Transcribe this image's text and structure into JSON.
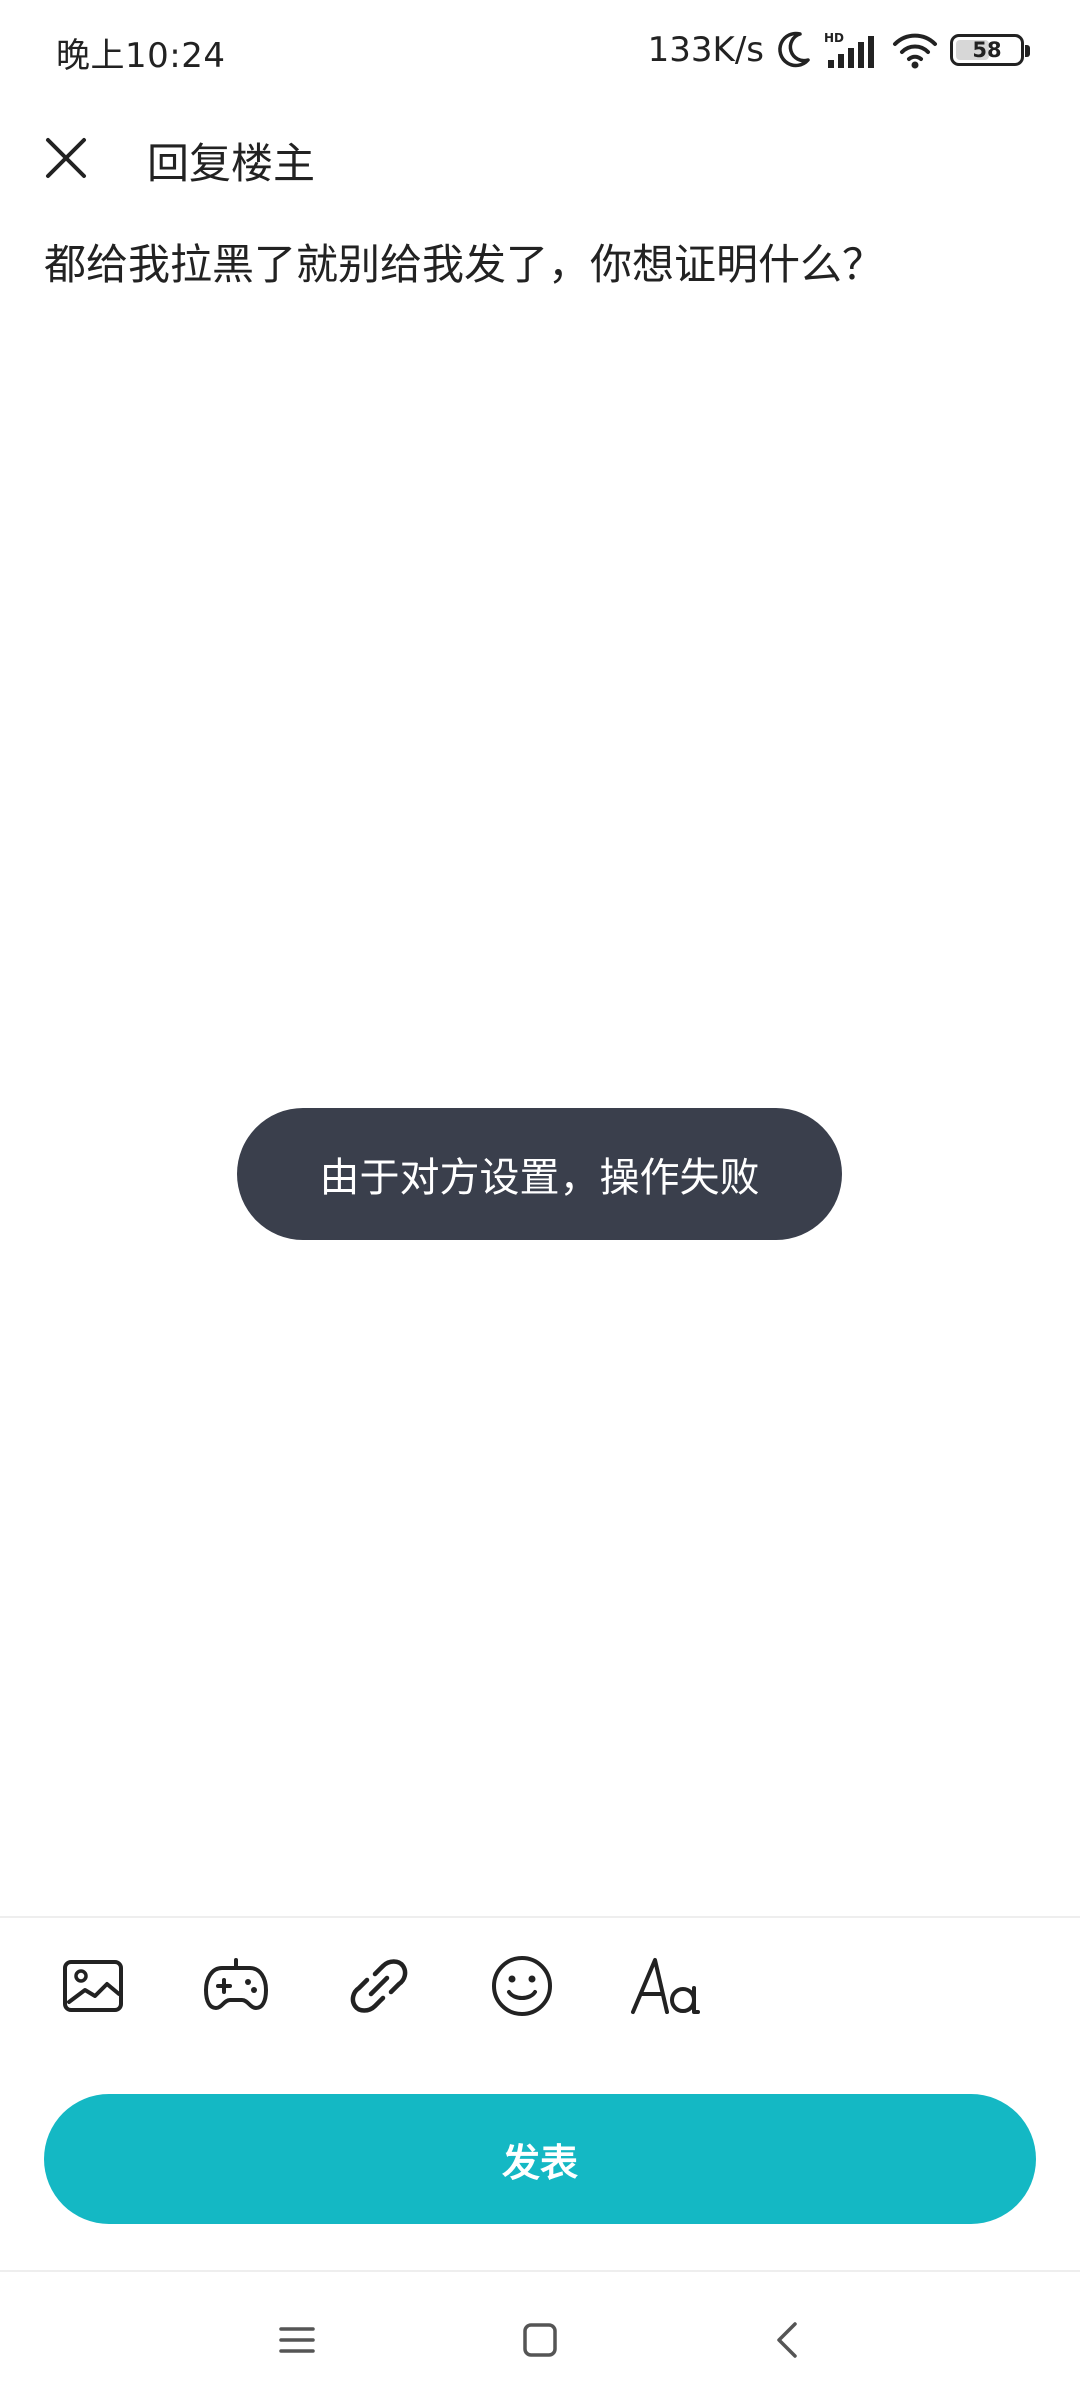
{
  "status_bar": {
    "time": "晚上10:24",
    "net_speed": "133K/s",
    "icons": [
      "moon-icon",
      "hd-signal-icon",
      "wifi-icon",
      "battery-icon"
    ],
    "battery_level": "58",
    "battery_fraction": 0.58
  },
  "header": {
    "close_icon": "close-icon",
    "title": "回复楼主"
  },
  "reply": {
    "text": "都给我拉黑了就别给我发了，你想证明什么？"
  },
  "toast": {
    "message": "由于对方设置，操作失败"
  },
  "toolbar": {
    "icons": [
      "image-icon",
      "gamepad-icon",
      "link-icon",
      "emoji-icon",
      "text-format-icon"
    ]
  },
  "submit": {
    "label": "发表",
    "color": "#14b8c4"
  },
  "nav_bar": {
    "icons": [
      "menu-icon",
      "home-icon",
      "back-icon"
    ]
  },
  "colors": {
    "accent": "#14b8c4",
    "toast_bg": "#3a3f4c",
    "text": "#222222"
  }
}
